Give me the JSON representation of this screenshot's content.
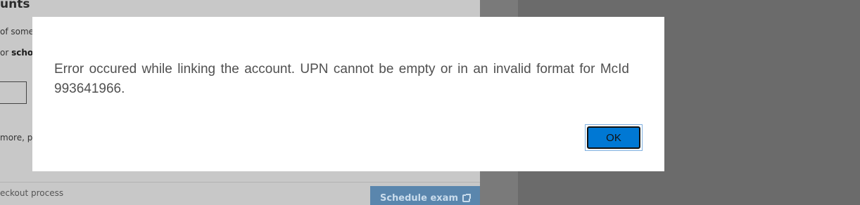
{
  "background": {
    "title_fragment": "unts",
    "line1_fragment": "of some",
    "line2_prefix": "or ",
    "line2_bold": "scho",
    "more_fragment": "more, p",
    "checkout_fragment": "eckout process",
    "schedule_button_label": "Schedule exam",
    "schedule_button_icon": "external-link-icon"
  },
  "dialog": {
    "message": "Error occured while linking the account. UPN cannot be empty or in an invalid format for McId 993641966.",
    "ok_label": "OK",
    "accent_color": "#0078d4"
  }
}
